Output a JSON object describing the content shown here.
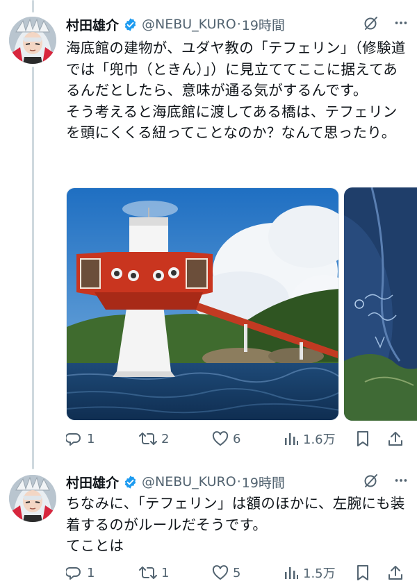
{
  "tweets": [
    {
      "display_name": "村田雄介",
      "handle": "@NEBU_KURO",
      "dot": "·",
      "time": "19時間",
      "text": "海底館の建物が、ユダヤ教の「テフェリン」（修験道では「兜巾（ときん）」）に見立ててここに据えてあるんだとしたら、意味が通る気がするんです。\nそう考えると海底館に渡してある橋は、テフェリンを頭にくくる紐ってことなのか？なんて思ったり。",
      "replies": "1",
      "retweets": "2",
      "likes": "6",
      "views": "1.6万"
    },
    {
      "display_name": "村田雄介",
      "handle": "@NEBU_KURO",
      "dot": "·",
      "time": "19時間",
      "text": "ちなみに、「テフェリン」は額のほかに、左腕にも装着するのがルールだそうです。\nてことは",
      "replies": "1",
      "retweets": "1",
      "likes": "5",
      "views": "1.5万"
    }
  ],
  "colors": {
    "verified": "#1d9bf0",
    "secondary_text": "#536471",
    "thread_line": "#cfd9de"
  },
  "icons": [
    "grok-icon",
    "more-icon",
    "reply-icon",
    "retweet-icon",
    "like-icon",
    "views-icon",
    "bookmark-icon",
    "share-icon"
  ]
}
